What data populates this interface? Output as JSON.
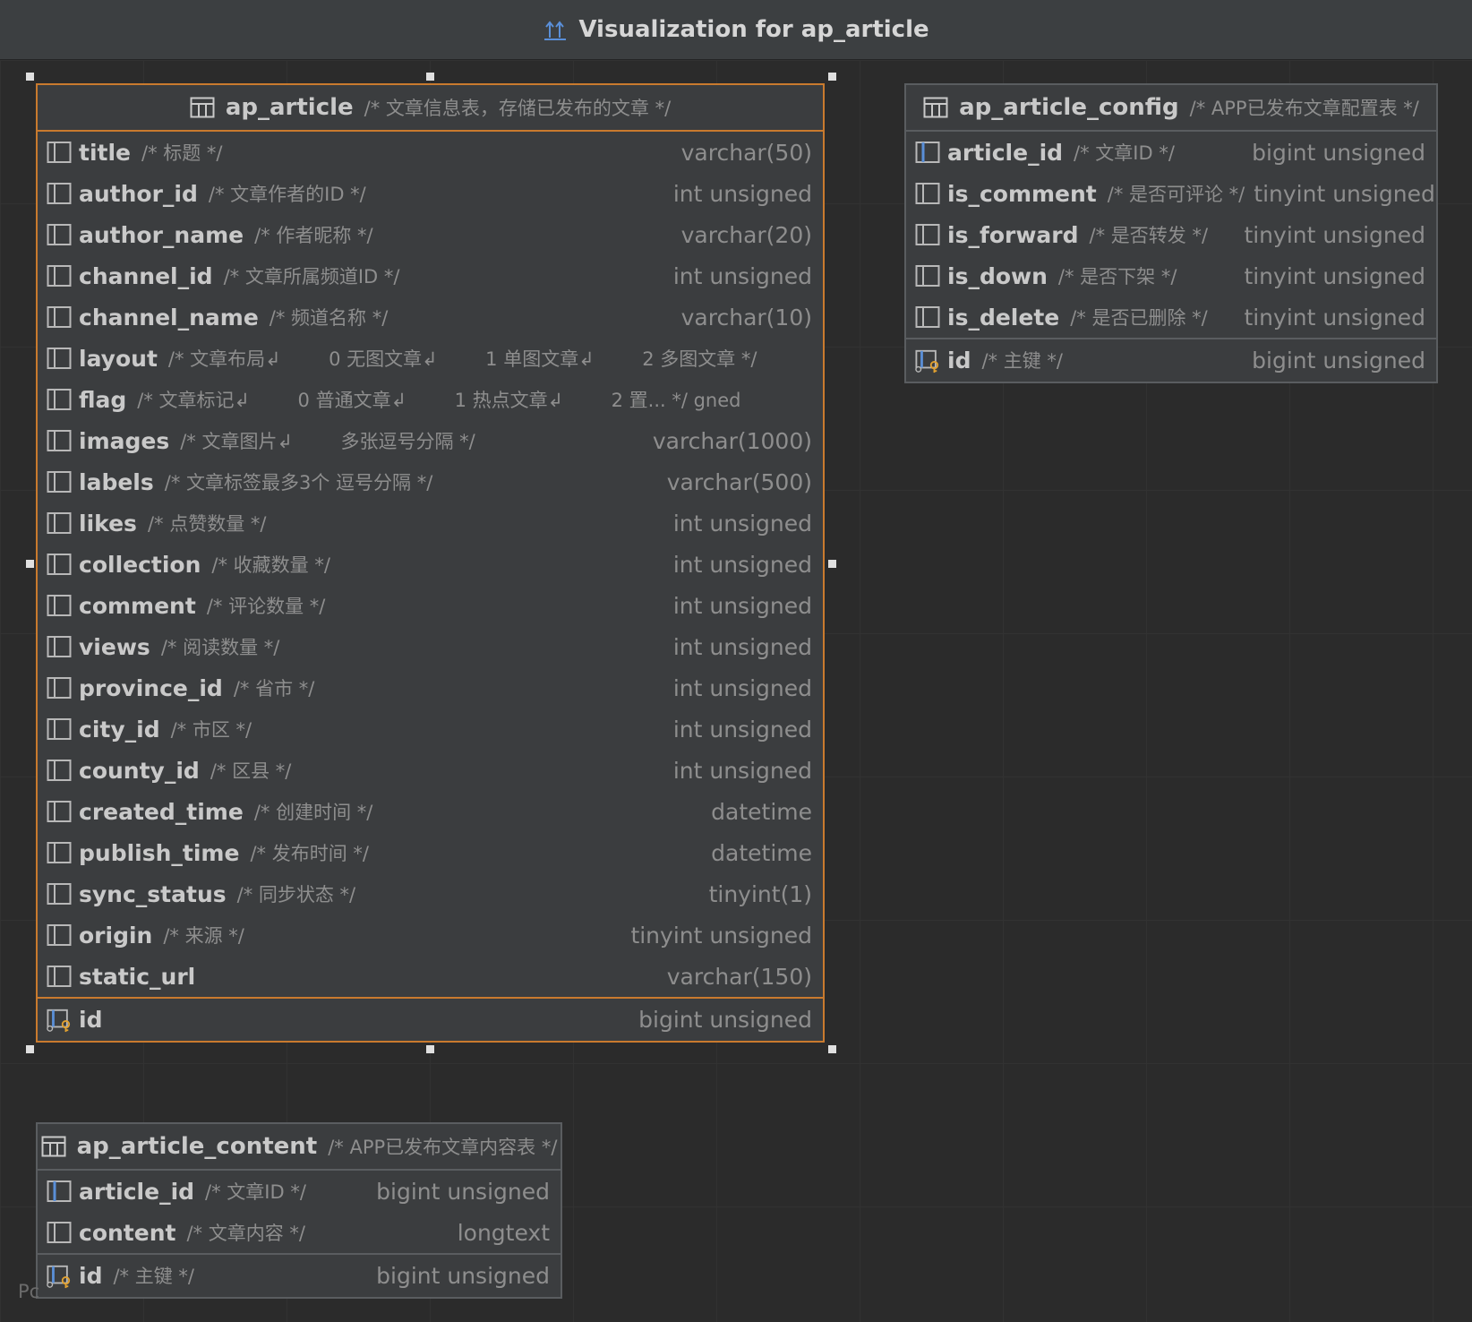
{
  "window": {
    "title": "Visualization for ap_article"
  },
  "footer": {
    "partial_text": "Pc"
  },
  "colors": {
    "selected_border": "#c97a2e",
    "pk_key": "#e0a030",
    "fk_blue": "#5a8fd8"
  },
  "tables": {
    "ap_article": {
      "name": "ap_article",
      "comment": "/* 文章信息表，存储已发布的文章 */",
      "columns": [
        {
          "name": "title",
          "comment": "/* 标题 */",
          "type": "varchar(50)",
          "icon": "column-icon"
        },
        {
          "name": "author_id",
          "comment": "/* 文章作者的ID */",
          "type": "int unsigned",
          "icon": "column-icon"
        },
        {
          "name": "author_name",
          "comment": "/* 作者昵称 */",
          "type": "varchar(20)",
          "icon": "column-icon"
        },
        {
          "name": "channel_id",
          "comment": "/* 文章所属频道ID */",
          "type": "int unsigned",
          "icon": "column-icon"
        },
        {
          "name": "channel_name",
          "comment": "/* 频道名称 */",
          "type": "varchar(10)",
          "icon": "column-icon"
        },
        {
          "name": "layout",
          "comment": "/* 文章布局↲        0 无图文章↲        1 单图文章↲        2 多图文章 */",
          "type": "",
          "icon": "column-icon"
        },
        {
          "name": "flag",
          "comment": "/* 文章标记↲        0 普通文章↲        1 热点文章↲        2 置... */ gned",
          "type": "",
          "icon": "column-icon"
        },
        {
          "name": "images",
          "comment": "/* 文章图片↲        多张逗号分隔 */",
          "type": "varchar(1000)",
          "icon": "column-icon"
        },
        {
          "name": "labels",
          "comment": "/* 文章标签最多3个 逗号分隔 */",
          "type": "varchar(500)",
          "icon": "column-icon"
        },
        {
          "name": "likes",
          "comment": "/* 点赞数量 */",
          "type": "int unsigned",
          "icon": "column-icon"
        },
        {
          "name": "collection",
          "comment": "/* 收藏数量 */",
          "type": "int unsigned",
          "icon": "column-icon"
        },
        {
          "name": "comment",
          "comment": "/* 评论数量 */",
          "type": "int unsigned",
          "icon": "column-icon"
        },
        {
          "name": "views",
          "comment": "/* 阅读数量 */",
          "type": "int unsigned",
          "icon": "column-icon"
        },
        {
          "name": "province_id",
          "comment": "/* 省市 */",
          "type": "int unsigned",
          "icon": "column-icon"
        },
        {
          "name": "city_id",
          "comment": "/* 市区 */",
          "type": "int unsigned",
          "icon": "column-icon"
        },
        {
          "name": "county_id",
          "comment": "/* 区县 */",
          "type": "int unsigned",
          "icon": "column-icon"
        },
        {
          "name": "created_time",
          "comment": "/* 创建时间 */",
          "type": "datetime",
          "icon": "column-icon"
        },
        {
          "name": "publish_time",
          "comment": "/* 发布时间 */",
          "type": "datetime",
          "icon": "column-icon"
        },
        {
          "name": "sync_status",
          "comment": "/* 同步状态 */",
          "type": "tinyint(1)",
          "icon": "column-icon"
        },
        {
          "name": "origin",
          "comment": "/* 来源 */",
          "type": "tinyint unsigned",
          "icon": "column-icon"
        },
        {
          "name": "static_url",
          "comment": "",
          "type": "varchar(150)",
          "icon": "column-icon"
        }
      ],
      "pk": {
        "name": "id",
        "comment": "",
        "type": "bigint unsigned",
        "icon": "primary-key-icon"
      }
    },
    "ap_article_config": {
      "name": "ap_article_config",
      "comment": "/* APP已发布文章配置表 */",
      "columns": [
        {
          "name": "article_id",
          "comment": "/* 文章ID */",
          "type": "bigint unsigned",
          "icon": "foreign-key-column-icon"
        },
        {
          "name": "is_comment",
          "comment": "/* 是否可评论 */",
          "type": "tinyint unsigned",
          "icon": "column-icon"
        },
        {
          "name": "is_forward",
          "comment": "/* 是否转发 */",
          "type": "tinyint unsigned",
          "icon": "column-icon"
        },
        {
          "name": "is_down",
          "comment": "/* 是否下架 */",
          "type": "tinyint unsigned",
          "icon": "column-icon"
        },
        {
          "name": "is_delete",
          "comment": "/* 是否已删除 */",
          "type": "tinyint unsigned",
          "icon": "column-icon"
        }
      ],
      "pk": {
        "name": "id",
        "comment": "/* 主键 */",
        "type": "bigint unsigned",
        "icon": "primary-key-icon"
      }
    },
    "ap_article_content": {
      "name": "ap_article_content",
      "comment": "/* APP已发布文章内容表 */",
      "columns": [
        {
          "name": "article_id",
          "comment": "/* 文章ID */",
          "type": "bigint unsigned",
          "icon": "foreign-key-column-icon"
        },
        {
          "name": "content",
          "comment": "/* 文章内容 */",
          "type": "longtext",
          "icon": "column-icon"
        }
      ],
      "pk": {
        "name": "id",
        "comment": "/* 主键 */",
        "type": "bigint unsigned",
        "icon": "primary-key-icon"
      }
    }
  }
}
